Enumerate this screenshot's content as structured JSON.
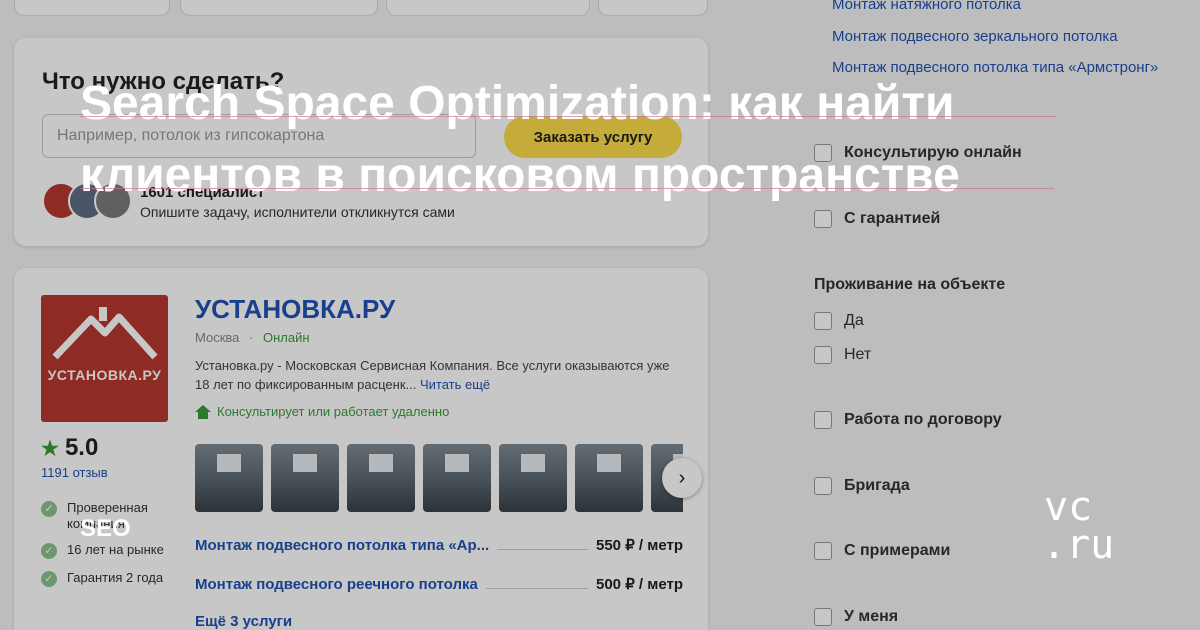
{
  "overlay": {
    "headline_line1": "Search Space Optimization: как найти",
    "headline_line2": "клиентов в поисковом пространстве",
    "tag": "SEO",
    "logo": "vc.ru"
  },
  "order_card": {
    "title": "Что нужно сделать?",
    "input_placeholder": "Например, потолок из гипсокартона",
    "button_label": "Заказать услугу",
    "specialists_count": "1601 специалист",
    "specialists_hint": "Опишите задачу, исполнители откликнутся сами"
  },
  "company": {
    "logo_text": "УСТАНОВКА.РУ",
    "name": "УСТАНОВКА.РУ",
    "city": "Москва",
    "separator": "·",
    "status": "Онлайн",
    "description": "Установка.ру - Московская Сервисная Компания. Все услуги оказываются уже 18 лет по фиксированным расценк...",
    "read_more": "Читать ещё",
    "remote": "Консультирует или работает удаленно",
    "rating": "5.0",
    "reviews": "1191 отзыв",
    "badges": [
      {
        "label": "Проверенная компания"
      },
      {
        "label": "16 лет на рынке"
      },
      {
        "label": "Гарантия 2 года"
      }
    ],
    "services": [
      {
        "name": "Монтаж подвесного потолка типа «Ар...",
        "price": "550 ₽ / метр"
      },
      {
        "name": "Монтаж подвесного реечного потолка",
        "price": "500 ₽ / метр"
      }
    ],
    "more_services": "Ещё 3 услуги"
  },
  "filters": {
    "links": [
      "Монтаж натяжного потолка",
      "Монтаж подвесного зеркального потолка",
      "Монтаж подвесного потолка типа «Армстронг»"
    ],
    "consult_label": "Консультирую онлайн",
    "warranty_label": "С гарантией",
    "residence_title": "Проживание на объекте",
    "residence_yes": "Да",
    "residence_no": "Нет",
    "contract_label": "Работа по договору",
    "brigade_label": "Бригада",
    "examples_label": "С примерами",
    "at_me_label": "У меня"
  },
  "colors": {
    "accent_link": "#1f52b4",
    "online_green": "#3c9a3c",
    "button_yellow": "#fddb4a",
    "logo_red": "#b5382f"
  }
}
